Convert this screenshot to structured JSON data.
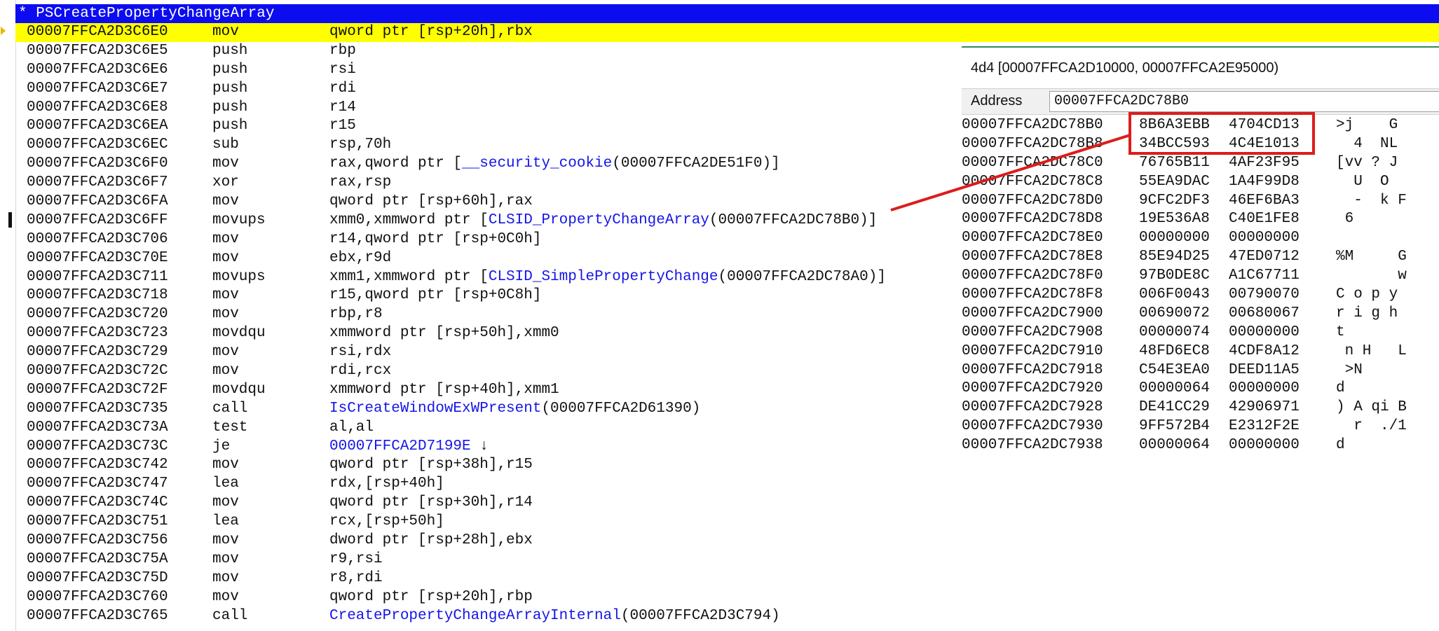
{
  "colors": {
    "title_bar_bg": "#0c0cf0",
    "current_line_bg": "#ffff00",
    "symbol_link": "#1515e8",
    "annotation_red": "#dd1c1c"
  },
  "disasm": {
    "title": "* PSCreatePropertyChangeArray",
    "rows": [
      {
        "addr": "00007FFCA2D3C6E0",
        "mn": "mov",
        "ops": "qword ptr [rsp+20h],rbx",
        "current": true
      },
      {
        "addr": "00007FFCA2D3C6E5",
        "mn": "push",
        "ops": "rbp"
      },
      {
        "addr": "00007FFCA2D3C6E6",
        "mn": "push",
        "ops": "rsi"
      },
      {
        "addr": "00007FFCA2D3C6E7",
        "mn": "push",
        "ops": "rdi"
      },
      {
        "addr": "00007FFCA2D3C6E8",
        "mn": "push",
        "ops": "r14"
      },
      {
        "addr": "00007FFCA2D3C6EA",
        "mn": "push",
        "ops": "r15"
      },
      {
        "addr": "00007FFCA2D3C6EC",
        "mn": "sub",
        "ops": "rsp,70h"
      },
      {
        "addr": "00007FFCA2D3C6F0",
        "mn": "mov",
        "ops": "rax,qword ptr [",
        "sym": "__security_cookie",
        "suffix": "(00007FFCA2DE51F0)]"
      },
      {
        "addr": "00007FFCA2D3C6F7",
        "mn": "xor",
        "ops": "rax,rsp"
      },
      {
        "addr": "00007FFCA2D3C6FA",
        "mn": "mov",
        "ops": "qword ptr [rsp+60h],rax"
      },
      {
        "addr": "00007FFCA2D3C6FF",
        "mn": "movups",
        "ops": "xmm0,xmmword ptr [",
        "sym": "CLSID_PropertyChangeArray",
        "suffix": "(00007FFCA2DC78B0)]"
      },
      {
        "addr": "00007FFCA2D3C706",
        "mn": "mov",
        "ops": "r14,qword ptr [rsp+0C0h]"
      },
      {
        "addr": "00007FFCA2D3C70E",
        "mn": "mov",
        "ops": "ebx,r9d"
      },
      {
        "addr": "00007FFCA2D3C711",
        "mn": "movups",
        "ops": "xmm1,xmmword ptr [",
        "sym": "CLSID_SimplePropertyChange",
        "suffix": "(00007FFCA2DC78A0)]"
      },
      {
        "addr": "00007FFCA2D3C718",
        "mn": "mov",
        "ops": "r15,qword ptr [rsp+0C8h]"
      },
      {
        "addr": "00007FFCA2D3C720",
        "mn": "mov",
        "ops": "rbp,r8"
      },
      {
        "addr": "00007FFCA2D3C723",
        "mn": "movdqu",
        "ops": "xmmword ptr [rsp+50h],xmm0"
      },
      {
        "addr": "00007FFCA2D3C729",
        "mn": "mov",
        "ops": "rsi,rdx"
      },
      {
        "addr": "00007FFCA2D3C72C",
        "mn": "mov",
        "ops": "rdi,rcx"
      },
      {
        "addr": "00007FFCA2D3C72F",
        "mn": "movdqu",
        "ops": "xmmword ptr [rsp+40h],xmm1"
      },
      {
        "addr": "00007FFCA2D3C735",
        "mn": "call",
        "ops": "",
        "sym": "IsCreateWindowExWPresent",
        "suffix": "(00007FFCA2D61390)"
      },
      {
        "addr": "00007FFCA2D3C73A",
        "mn": "test",
        "ops": "al,al"
      },
      {
        "addr": "00007FFCA2D3C73C",
        "mn": "je",
        "ops": "",
        "sym": "00007FFCA2D7199E",
        "suffix": " ↓"
      },
      {
        "addr": "00007FFCA2D3C742",
        "mn": "mov",
        "ops": "qword ptr [rsp+38h],r15"
      },
      {
        "addr": "00007FFCA2D3C747",
        "mn": "lea",
        "ops": "rdx,[rsp+40h]"
      },
      {
        "addr": "00007FFCA2D3C74C",
        "mn": "mov",
        "ops": "qword ptr [rsp+30h],r14"
      },
      {
        "addr": "00007FFCA2D3C751",
        "mn": "lea",
        "ops": "rcx,[rsp+50h]"
      },
      {
        "addr": "00007FFCA2D3C756",
        "mn": "mov",
        "ops": "dword ptr [rsp+28h],ebx"
      },
      {
        "addr": "00007FFCA2D3C75A",
        "mn": "mov",
        "ops": "r9,rsi"
      },
      {
        "addr": "00007FFCA2D3C75D",
        "mn": "mov",
        "ops": "r8,rdi"
      },
      {
        "addr": "00007FFCA2D3C760",
        "mn": "mov",
        "ops": "qword ptr [rsp+20h],rbp"
      },
      {
        "addr": "00007FFCA2D3C765",
        "mn": "call",
        "ops": "",
        "sym": "CreatePropertyChangeArrayInternal",
        "suffix": "(00007FFCA2D3C794)"
      }
    ]
  },
  "memory": {
    "title": "4d4 [00007FFCA2D10000, 00007FFCA2E95000)",
    "address_label": "Address",
    "address_value": "00007FFCA2DC78B0",
    "rows": [
      {
        "addr": "00007FFCA2DC78B0",
        "d1": "8B6A3EBB",
        "d2": "4704CD13",
        "ascii": ">j    G"
      },
      {
        "addr": "00007FFCA2DC78B8",
        "d1": "34BCC593",
        "d2": "4C4E1013",
        "ascii": "  4  NL"
      },
      {
        "addr": "00007FFCA2DC78C0",
        "d1": "76765B11",
        "d2": "4AF23F95",
        "ascii": "[vv ? J"
      },
      {
        "addr": "00007FFCA2DC78C8",
        "d1": "55EA9DAC",
        "d2": "1A4F99D8",
        "ascii": "  U  O"
      },
      {
        "addr": "00007FFCA2DC78D0",
        "d1": "9CFC2DF3",
        "d2": "46EF6BA3",
        "ascii": "  -  k F"
      },
      {
        "addr": "00007FFCA2DC78D8",
        "d1": "19E536A8",
        "d2": "C40E1FE8",
        "ascii": " 6"
      },
      {
        "addr": "00007FFCA2DC78E0",
        "d1": "00000000",
        "d2": "00000000",
        "ascii": ""
      },
      {
        "addr": "00007FFCA2DC78E8",
        "d1": "85E94D25",
        "d2": "47ED0712",
        "ascii": "%M     G"
      },
      {
        "addr": "00007FFCA2DC78F0",
        "d1": "97B0DE8C",
        "d2": "A1C67711",
        "ascii": "       w"
      },
      {
        "addr": "00007FFCA2DC78F8",
        "d1": "006F0043",
        "d2": "00790070",
        "ascii": "C o p y"
      },
      {
        "addr": "00007FFCA2DC7900",
        "d1": "00690072",
        "d2": "00680067",
        "ascii": "r i g h"
      },
      {
        "addr": "00007FFCA2DC7908",
        "d1": "00000074",
        "d2": "00000000",
        "ascii": "t"
      },
      {
        "addr": "00007FFCA2DC7910",
        "d1": "48FD6EC8",
        "d2": "4CDF8A12",
        "ascii": " n H   L"
      },
      {
        "addr": "00007FFCA2DC7918",
        "d1": "C54E3EA0",
        "d2": "DEED11A5",
        "ascii": " >N"
      },
      {
        "addr": "00007FFCA2DC7920",
        "d1": "00000064",
        "d2": "00000000",
        "ascii": "d"
      },
      {
        "addr": "00007FFCA2DC7928",
        "d1": "DE41CC29",
        "d2": "42906971",
        "ascii": ") A qi B"
      },
      {
        "addr": "00007FFCA2DC7930",
        "d1": "9FF572B4",
        "d2": "E2312F2E",
        "ascii": "  r  ./1"
      },
      {
        "addr": "00007FFCA2DC7938",
        "d1": "00000064",
        "d2": "00000000",
        "ascii": "d"
      }
    ]
  }
}
